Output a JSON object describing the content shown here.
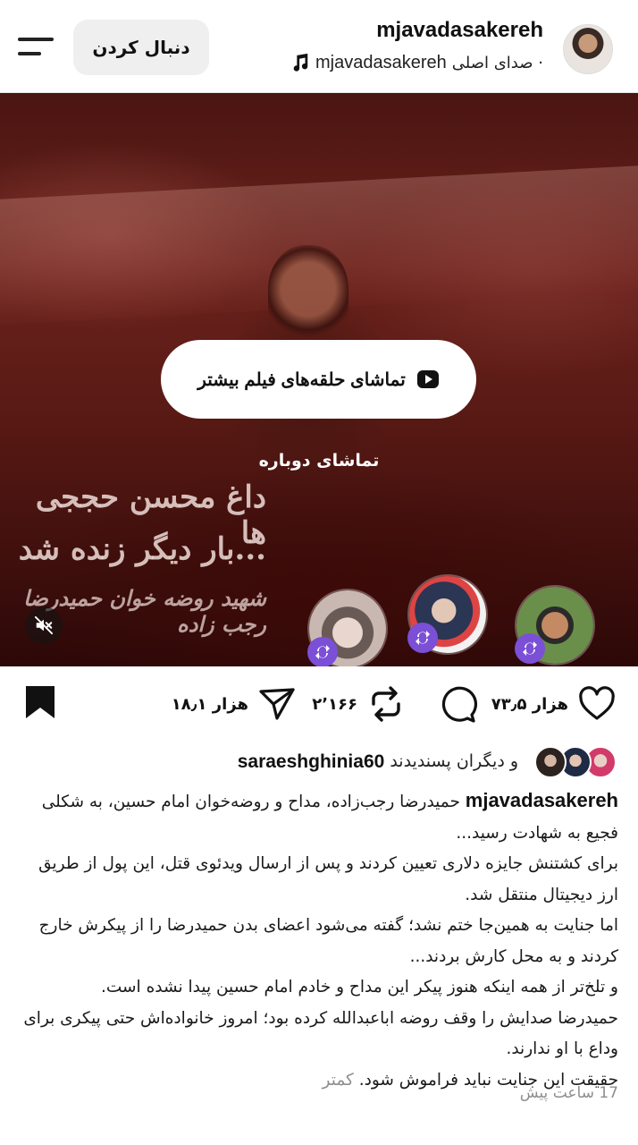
{
  "header": {
    "username": "mjavadasakereh",
    "audio_user": "mjavadasakereh",
    "audio_label": "صدای اصلی ·",
    "follow_label": "دنبال کردن",
    "menu_icon": "hamburger-icon",
    "music_icon": "music-note-icon"
  },
  "video": {
    "watch_more_label": "تماشای حلقه‌های فیلم بیشتر",
    "rewatch_label": "تماشای دوباره",
    "overlay_line1": "داغ محسن حججی ها",
    "overlay_line2": "بار دیگر زنده شد...",
    "overlay_line3": "شهید روضه خوان حمیدرضا رجب زاده",
    "mute_icon": "speaker-muted-icon",
    "remix_icon": "remix-icon"
  },
  "actions": {
    "likes_count": "۷۳٫۵ هزار",
    "reposts_count": "۲٬۱۶۶",
    "shares_count": "۱۸٫۱ هزار",
    "like_icon": "heart-icon",
    "comment_icon": "comment-icon",
    "repost_icon": "repost-icon",
    "share_icon": "send-icon",
    "save_icon": "bookmark-icon"
  },
  "likes": {
    "liker": "saraeshghinia60",
    "others_text": "و دیگران پسندیدند"
  },
  "caption": {
    "user": "mjavadasakereh",
    "line1": " حمیدرضا رجب‌زاده، مداح و روضه‌خوان امام حسین، به شکلی فجیع به شهادت رسید...",
    "line2": "برای کشتنش جایزه دلاری تعیین کردند و پس از ارسال ویدئوی قتل، این پول از طریق ارز دیجیتال منتقل شد.",
    "line3": "اما جنایت به همین‌جا ختم نشد؛ گفته می‌شود اعضای بدن حمیدرضا را از پیکرش خارج کردند و به محل کارش بردند...",
    "line4": "و تلخ‌تر از همه اینکه هنوز پیکر این مداح و خادم امام حسین پیدا نشده است.",
    "line5": "حمیدرضا صدایش را وقف روضه اباعبدالله کرده بود؛ امروز خانواده‌اش حتی پیکری برای وداع با او ندارند.",
    "line6": "حقیقت این جنایت نباید فراموش شود. ",
    "less_label": "کمتر"
  },
  "timestamp": "17 ساعت پیش"
}
